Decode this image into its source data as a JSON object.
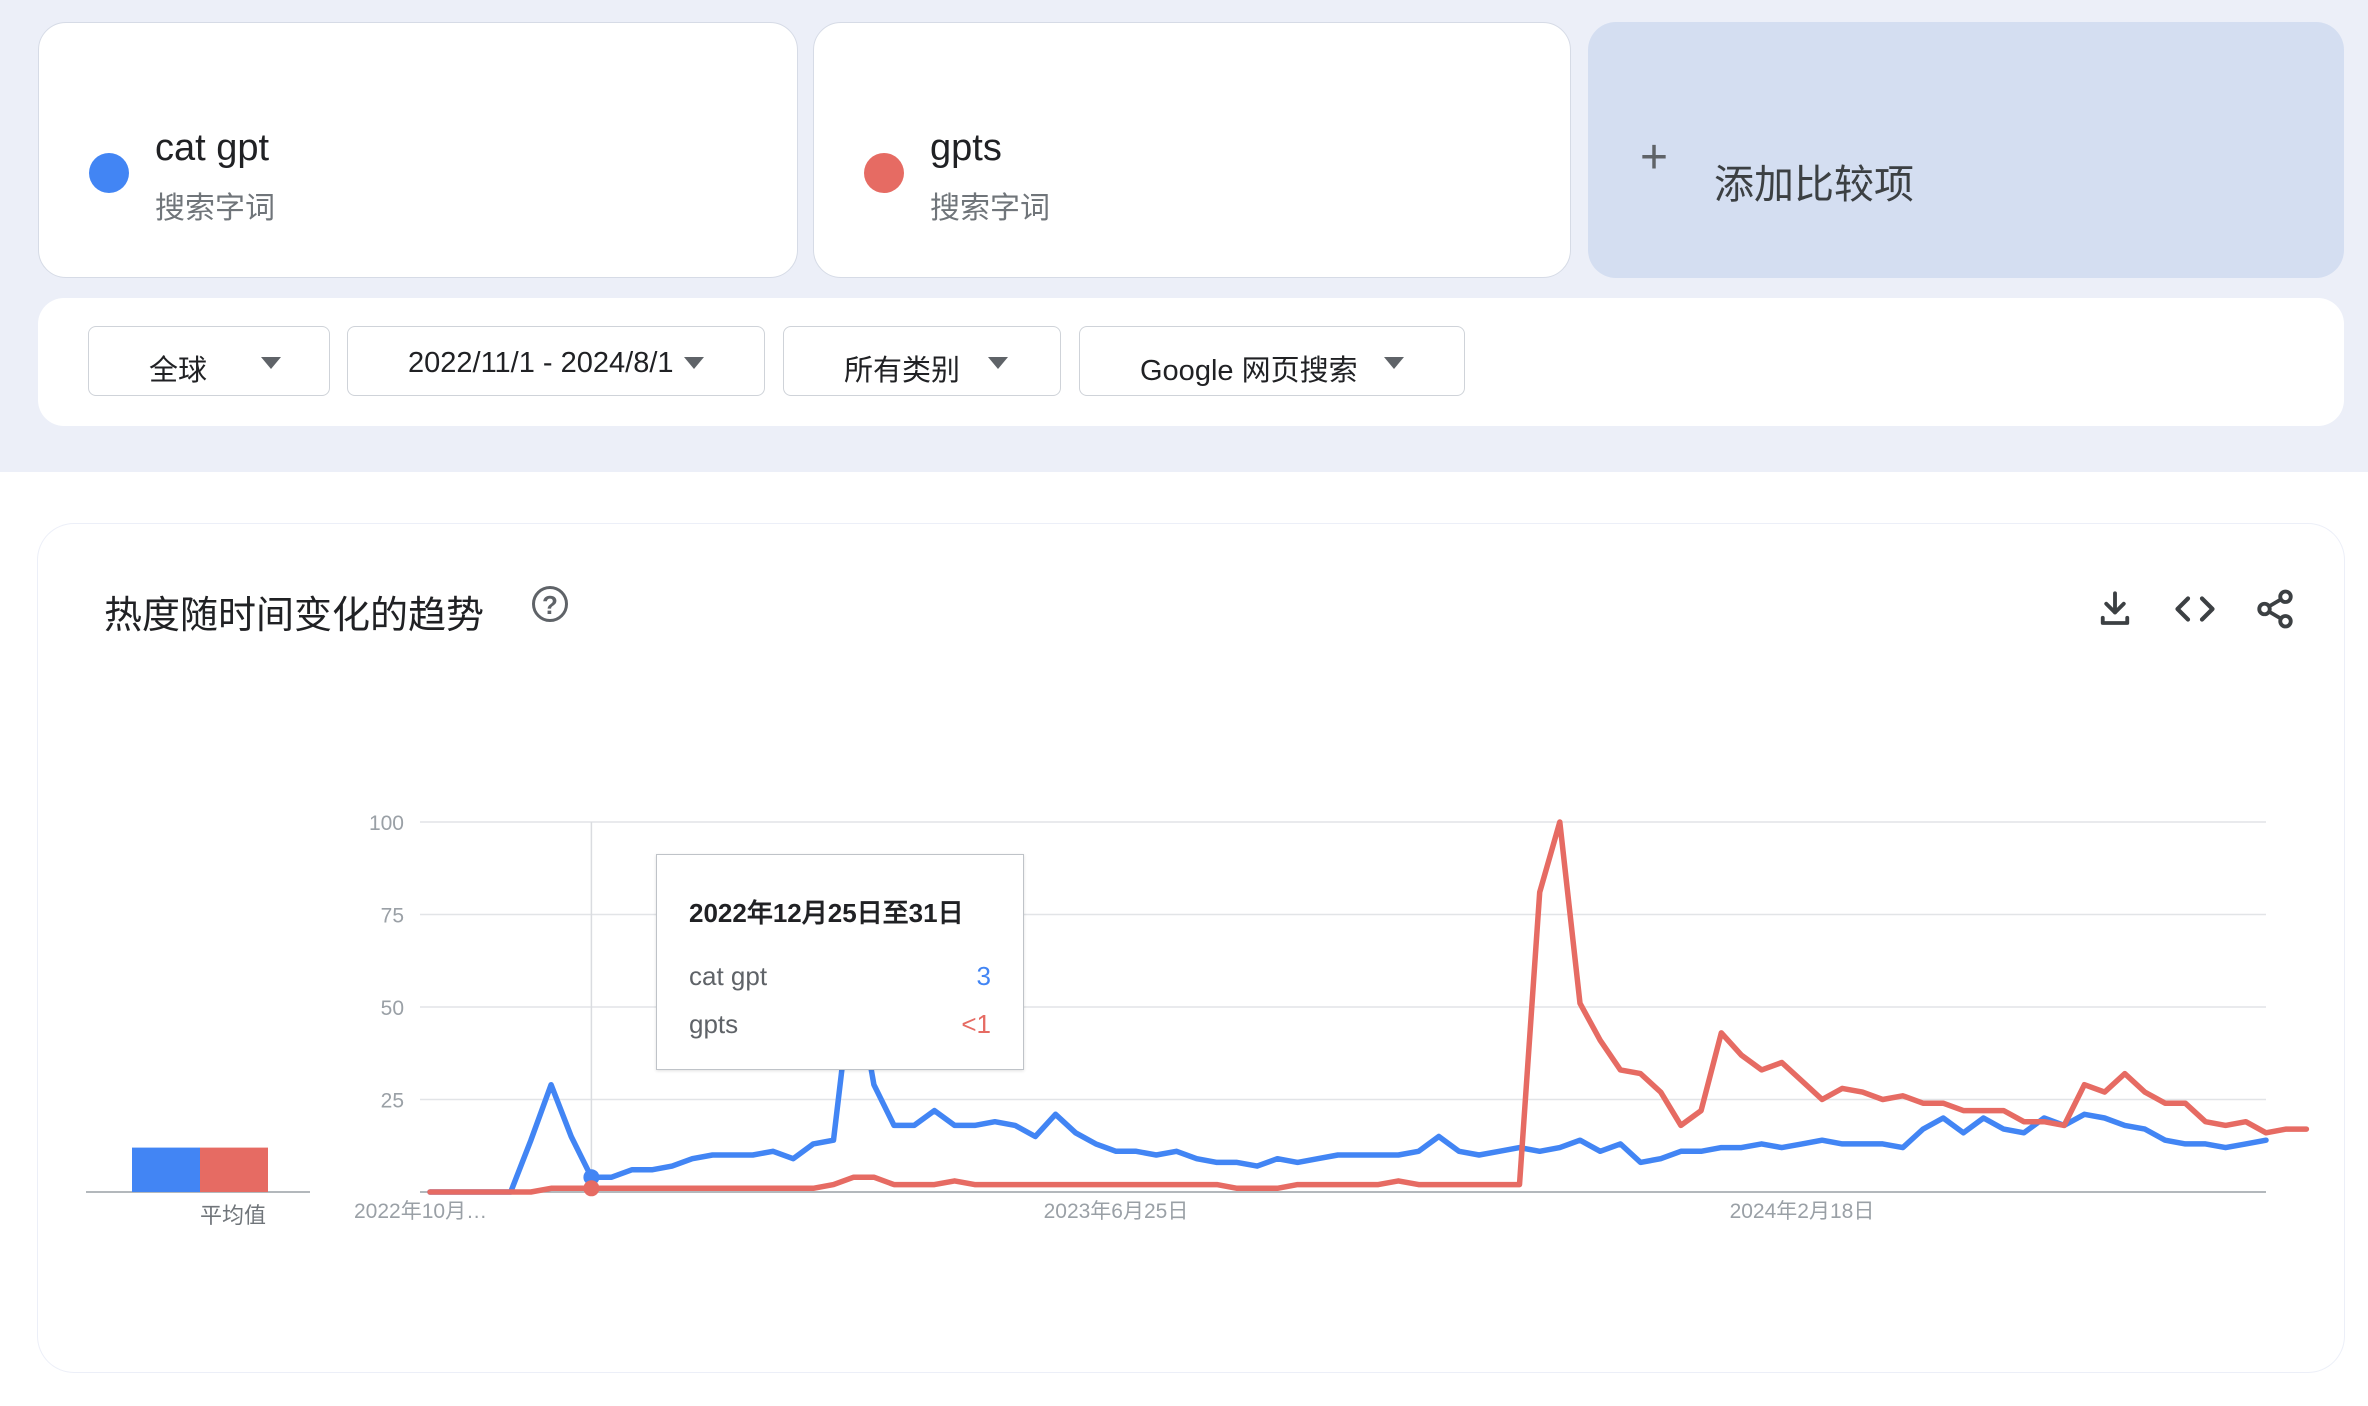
{
  "terms": [
    {
      "name": "cat gpt",
      "type": "搜索字词",
      "color": "#4285f4"
    },
    {
      "name": "gpts",
      "type": "搜索字词",
      "color": "#e66b63"
    }
  ],
  "add_compare": {
    "icon": "plus-icon",
    "label": "添加比较项"
  },
  "filters": {
    "region": "全球",
    "date_range": "2022/11/1 - 2024/8/1",
    "category": "所有类别",
    "search_type": "Google 网页搜索"
  },
  "chart": {
    "title": "热度随时间变化的趋势",
    "help_icon": "help-circle-icon",
    "help_glyph": "?",
    "tools": [
      "download-icon",
      "embed-code-icon",
      "share-icon"
    ],
    "avg_label": "平均值"
  },
  "tooltip": {
    "date": "2022年12月25日至31日",
    "rows": [
      {
        "term": "cat gpt",
        "value": "3",
        "color": "#4285f4"
      },
      {
        "term": "gpts",
        "value": "<1",
        "color": "#e66b63"
      }
    ]
  },
  "chart_data": {
    "type": "line",
    "ylim": [
      0,
      100
    ],
    "y_ticks": [
      25,
      50,
      75,
      100
    ],
    "x_tick_labels": [
      {
        "label": "2022年10月…",
        "index": 0
      },
      {
        "label": "2023年6月25日",
        "index": 34
      },
      {
        "label": "2024年2月18日",
        "index": 68
      }
    ],
    "highlight_index": 8,
    "averages": [
      {
        "name": "cat gpt",
        "value": 12
      },
      {
        "name": "gpts",
        "value": 12
      }
    ],
    "series": [
      {
        "name": "cat gpt",
        "color": "#4285f4",
        "values": [
          0,
          0,
          0,
          0,
          0,
          14,
          29,
          15,
          4,
          4,
          6,
          6,
          7,
          9,
          10,
          10,
          10,
          11,
          9,
          13,
          14,
          60,
          29,
          18,
          18,
          22,
          18,
          18,
          19,
          18,
          15,
          21,
          16,
          13,
          11,
          11,
          10,
          11,
          9,
          8,
          8,
          7,
          9,
          8,
          9,
          10,
          10,
          10,
          10,
          11,
          15,
          11,
          10,
          11,
          12,
          11,
          12,
          14,
          11,
          13,
          8,
          9,
          11,
          11,
          12,
          12,
          13,
          12,
          13,
          14,
          13,
          13,
          13,
          12,
          17,
          20,
          16,
          20,
          17,
          16,
          20,
          18,
          21,
          20,
          18,
          17,
          14,
          13,
          13,
          12,
          13,
          14
        ]
      },
      {
        "name": "gpts",
        "color": "#e66b63",
        "values": [
          0,
          0,
          0,
          0,
          0,
          0,
          1,
          1,
          1,
          1,
          1,
          1,
          1,
          1,
          1,
          1,
          1,
          1,
          1,
          1,
          2,
          4,
          4,
          2,
          2,
          2,
          3,
          2,
          2,
          2,
          2,
          2,
          2,
          2,
          2,
          2,
          2,
          2,
          2,
          2,
          1,
          1,
          1,
          2,
          2,
          2,
          2,
          2,
          3,
          2,
          2,
          2,
          2,
          2,
          2,
          81,
          100,
          51,
          41,
          33,
          32,
          27,
          18,
          22,
          43,
          37,
          33,
          35,
          30,
          25,
          28,
          27,
          25,
          26,
          24,
          24,
          22,
          22,
          22,
          19,
          19,
          18,
          29,
          27,
          32,
          27,
          24,
          24,
          19,
          18,
          19,
          16,
          17,
          17
        ]
      }
    ]
  }
}
